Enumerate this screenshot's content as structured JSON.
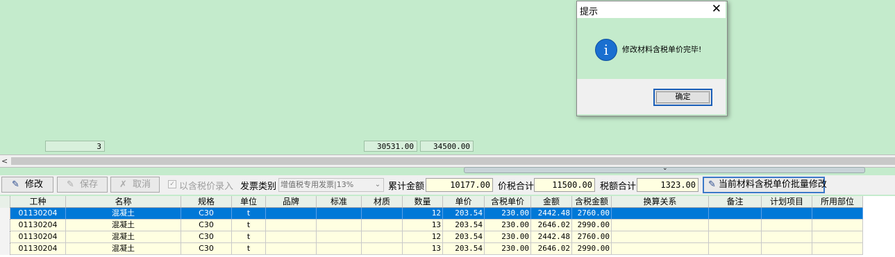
{
  "totals": {
    "count": "3",
    "sum_amount": "30531.00",
    "sum_tax_amount": "34500.00"
  },
  "scroll": {
    "left_arrow": "<",
    "splitter_arrow": "⌄"
  },
  "toolbar": {
    "edit_label": "修改",
    "save_label": "保存",
    "cancel_label": "取消",
    "taxed_price_entry_label": "以含税价录入",
    "invoice_type_label": "发票类别",
    "invoice_type_value": "增值税专用发票|13%",
    "cumulative_amount_label": "累计金额",
    "cumulative_amount_value": "10177.00",
    "price_tax_total_label": "价税合计",
    "price_tax_total_value": "11500.00",
    "tax_total_label": "税额合计",
    "tax_total_value": "1323.00",
    "batch_modify_label": "当前材料含税单价批量修改"
  },
  "table": {
    "headers": [
      "工种",
      "名称",
      "规格",
      "单位",
      "品牌",
      "标准",
      "材质",
      "数量",
      "单价",
      "含税单价",
      "金额",
      "含税金额",
      "换算关系",
      "备注",
      "计划项目",
      "所用部位"
    ],
    "rows": [
      [
        "01130204",
        "混凝土",
        "C30",
        "t",
        "",
        "",
        "",
        "12",
        "203.54",
        "230.00",
        "2442.48",
        "2760.00",
        "",
        "",
        "",
        ""
      ],
      [
        "01130204",
        "混凝土",
        "C30",
        "t",
        "",
        "",
        "",
        "13",
        "203.54",
        "230.00",
        "2646.02",
        "2990.00",
        "",
        "",
        "",
        ""
      ],
      [
        "01130204",
        "混凝土",
        "C30",
        "t",
        "",
        "",
        "",
        "12",
        "203.54",
        "230.00",
        "2442.48",
        "2760.00",
        "",
        "",
        "",
        ""
      ],
      [
        "01130204",
        "混凝土",
        "C30",
        "t",
        "",
        "",
        "",
        "13",
        "203.54",
        "230.00",
        "2646.02",
        "2990.00",
        "",
        "",
        "",
        ""
      ]
    ]
  },
  "dialog": {
    "title": "提示",
    "close_glyph": "✕",
    "icon_glyph": "i",
    "message": "修改材料含税单价完毕!",
    "ok_label": "确定"
  },
  "colors": {
    "background": "#c4ebcc",
    "selection": "#0078d7",
    "row": "#ffffe1",
    "accent": "#1b5fb9"
  },
  "icons": {
    "edit": "pen-icon",
    "save": "pen-icon",
    "cancel": "cross-icon",
    "info": "info-icon"
  }
}
